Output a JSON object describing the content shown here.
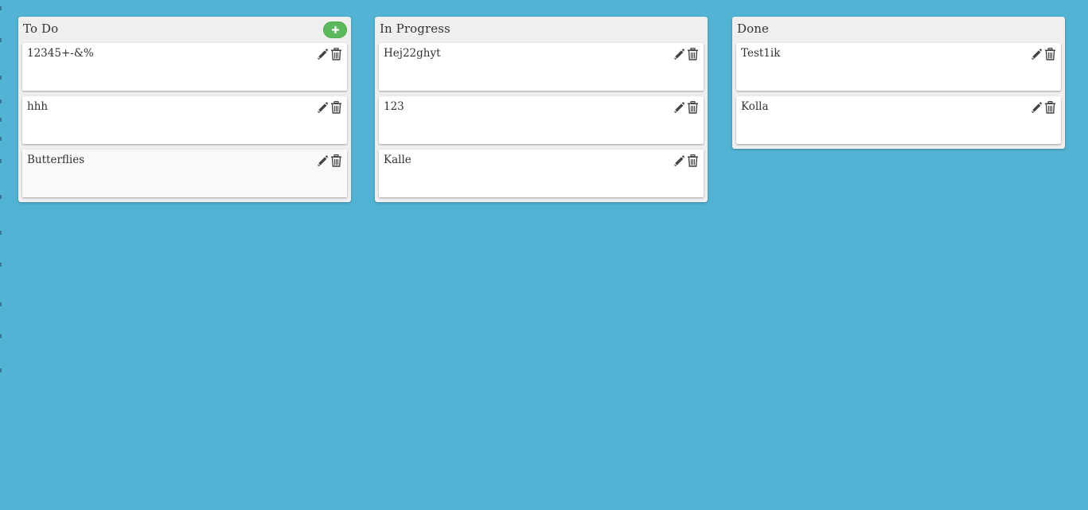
{
  "board": {
    "accent_color": "#53b3d4",
    "add_button_color": "#5cb85c",
    "columns": [
      {
        "title": "To Do",
        "has_add_button": true,
        "cards": [
          {
            "text": "12345+-&%"
          },
          {
            "text": "hhh"
          },
          {
            "text": "Butterflies"
          }
        ]
      },
      {
        "title": "In Progress",
        "has_add_button": false,
        "cards": [
          {
            "text": "Hej22ghyt"
          },
          {
            "text": "123"
          },
          {
            "text": "Kalle"
          }
        ]
      },
      {
        "title": "Done",
        "has_add_button": false,
        "cards": [
          {
            "text": "Test1ik"
          },
          {
            "text": "Kolla"
          }
        ]
      }
    ],
    "icons": {
      "add": "plus-icon",
      "edit": "pencil-icon",
      "delete": "trash-icon"
    }
  }
}
